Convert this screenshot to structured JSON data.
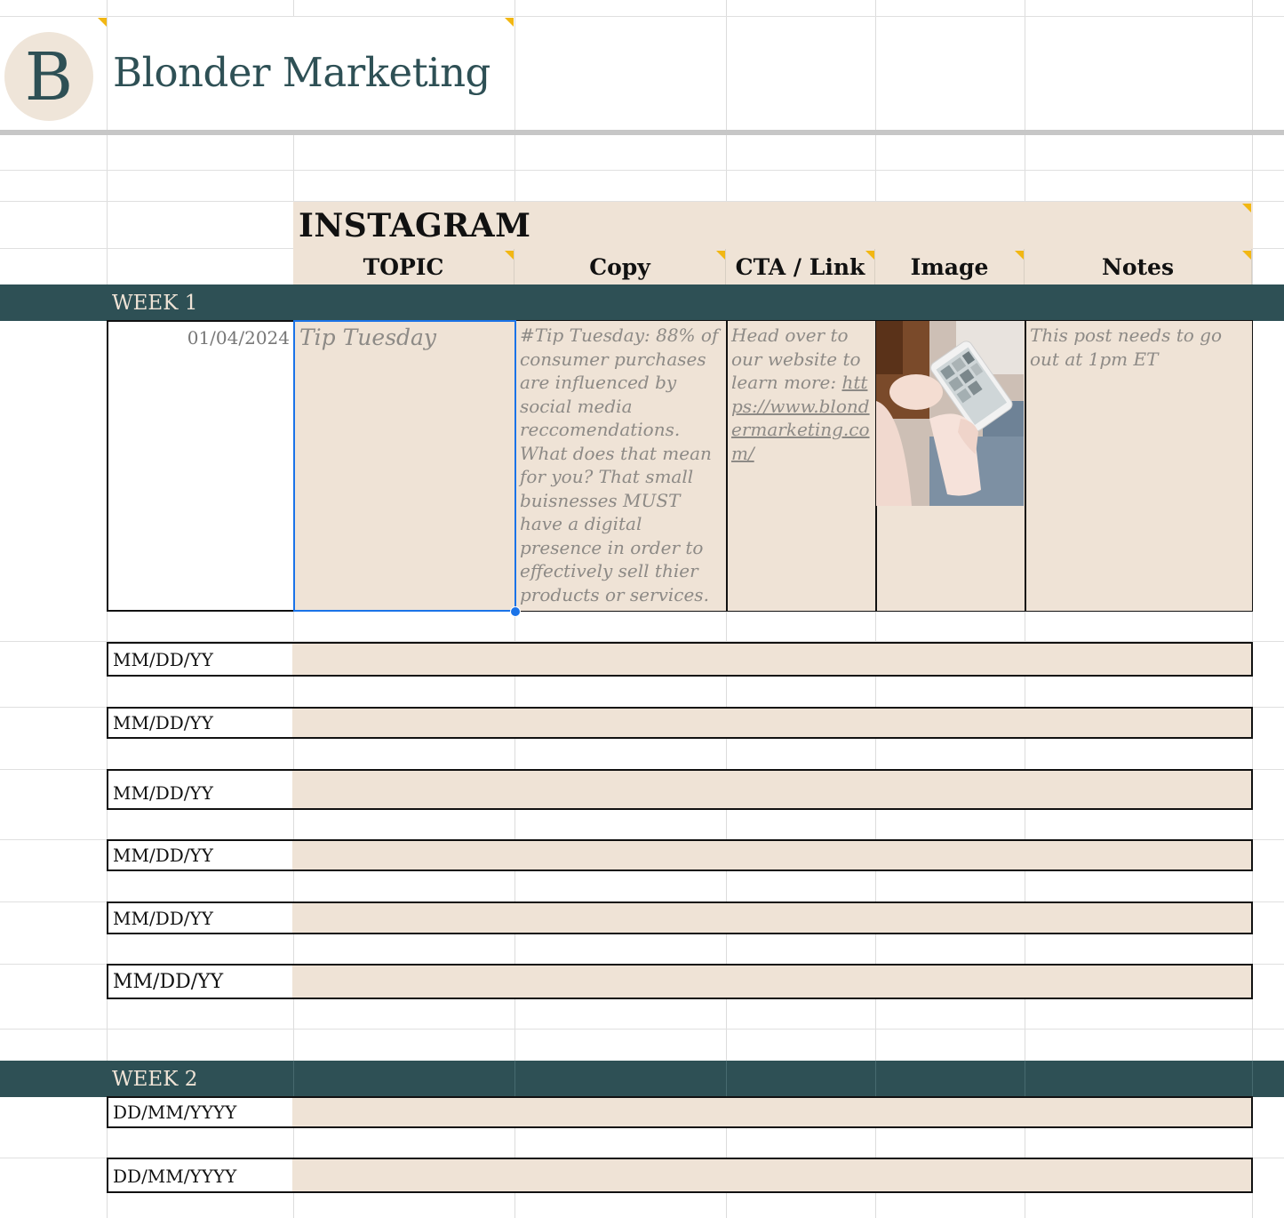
{
  "brand": {
    "logo_letter": "B",
    "name": "Blonder Marketing"
  },
  "section_title": "INSTAGRAM",
  "columns": [
    "TOPIC",
    "Copy",
    "CTA / Link",
    "Image",
    "Notes"
  ],
  "weeks": [
    {
      "label": "WEEK 1"
    },
    {
      "label": "WEEK 2"
    }
  ],
  "first_post": {
    "date": "01/04/2024",
    "topic": "Tip Tuesday",
    "copy": "#Tip Tuesday: 88% of consumer purchases are influenced by social media reccomendations. What does that mean for you? That small buisnesses MUST have a digital presence in order to effectively sell thier products or services.",
    "cta_text": "Head over to our website to learn more:",
    "cta_link": "https://www.blondermarketing.com/",
    "image_alt": "hands holding phone photo",
    "notes": "This post needs to go out at 1pm ET"
  },
  "week1_rows": [
    "MM/DD/YY",
    "MM/DD/YY",
    "MM/DD/YY",
    "MM/DD/YY",
    "MM/DD/YY",
    "MM/DD/YY"
  ],
  "week2_rows": [
    "DD/MM/YYYY",
    "DD/MM/YYYY"
  ],
  "colors": {
    "teal": "#2e5055",
    "beige": "#efe3d6",
    "selection": "#1a73e8",
    "comment_marker": "#f2b713"
  }
}
